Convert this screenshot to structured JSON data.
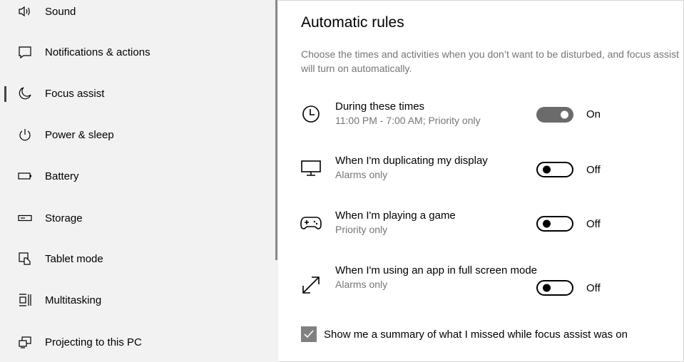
{
  "sidebar": {
    "items": [
      {
        "label": "Sound",
        "icon": "speaker-icon"
      },
      {
        "label": "Notifications & actions",
        "icon": "message-icon"
      },
      {
        "label": "Focus assist",
        "icon": "moon-icon"
      },
      {
        "label": "Power & sleep",
        "icon": "power-icon"
      },
      {
        "label": "Battery",
        "icon": "battery-icon"
      },
      {
        "label": "Storage",
        "icon": "storage-icon"
      },
      {
        "label": "Tablet mode",
        "icon": "tablet-mode-icon"
      },
      {
        "label": "Multitasking",
        "icon": "multitasking-icon"
      },
      {
        "label": "Projecting to this PC",
        "icon": "projecting-icon"
      }
    ],
    "active_index": 2
  },
  "main": {
    "title": "Automatic rules",
    "description": "Choose the times and activities when you don’t want to be disturbed, and focus assist will turn on automatically.",
    "rules": [
      {
        "name": "During these times",
        "sub": "11:00 PM - 7:00 AM; Priority only",
        "state": "On",
        "icon": "clock-icon"
      },
      {
        "name": "When I'm duplicating my display",
        "sub": "Alarms only",
        "state": "Off",
        "icon": "monitor-icon"
      },
      {
        "name": "When I'm playing a game",
        "sub": "Priority only",
        "state": "Off",
        "icon": "gamepad-icon"
      },
      {
        "name": "When I'm using an app in full screen mode",
        "sub": "Alarms only",
        "state": "Off",
        "icon": "fullscreen-icon"
      }
    ],
    "summary_checkbox": {
      "label": "Show me a summary of what I missed while focus assist was on",
      "checked": true
    }
  }
}
